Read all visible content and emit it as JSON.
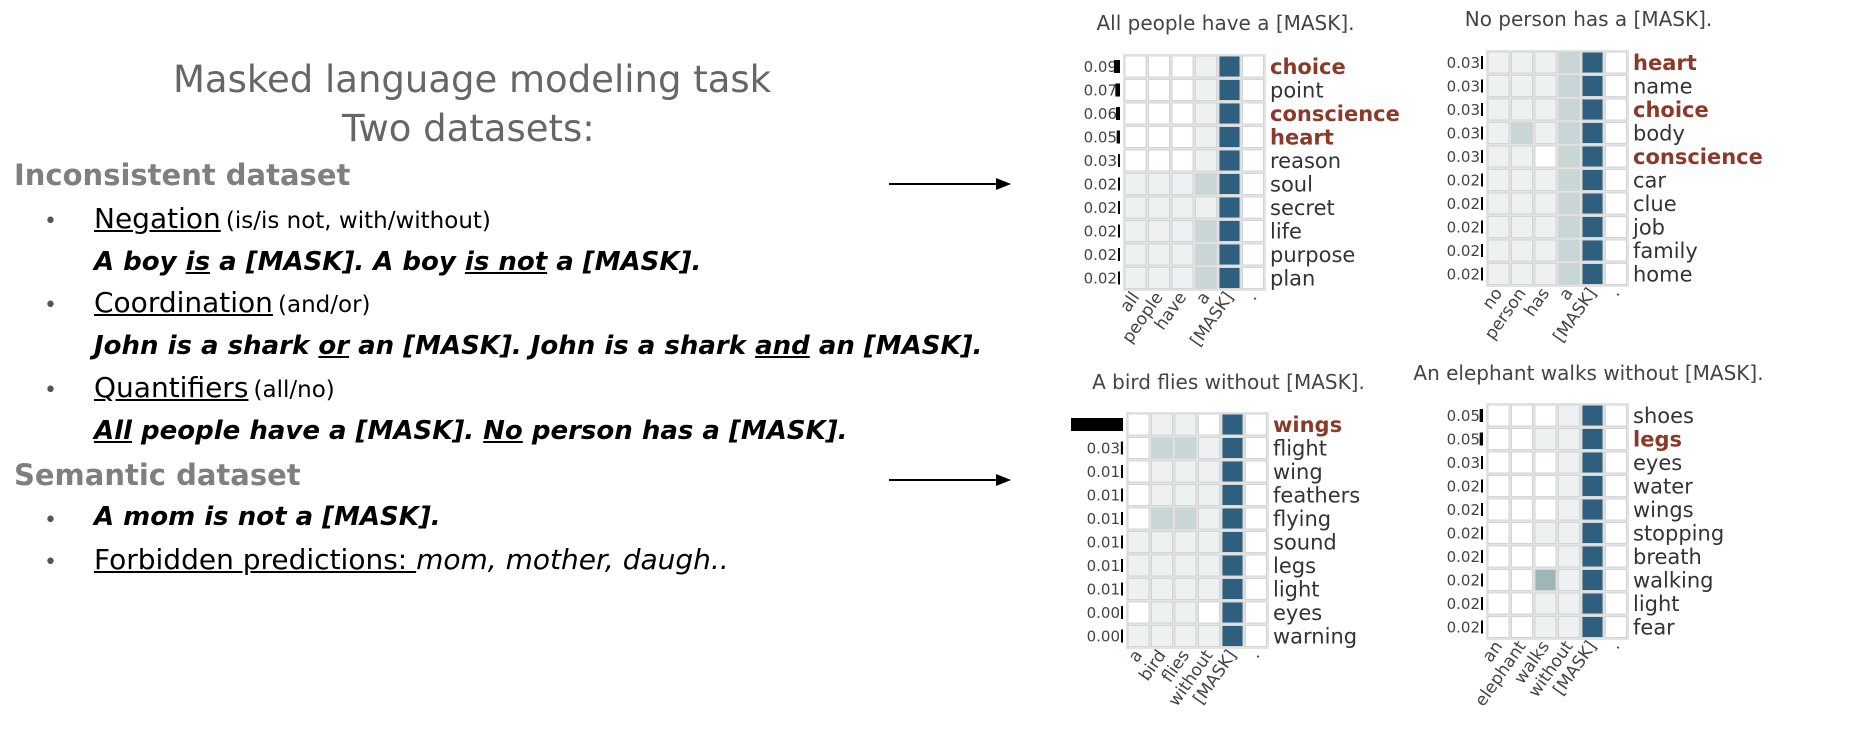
{
  "left": {
    "title_line1": "Masked language modeling task",
    "title_line2": "Two datasets:",
    "inconsistent_heading": "Inconsistent dataset",
    "items": [
      {
        "label": "Negation",
        "note": "(is/is not, with/without)",
        "example_parts": [
          "A boy ",
          "is",
          " a [MASK]. A boy ",
          "is not",
          " a [MASK]."
        ]
      },
      {
        "label": "Coordination",
        "note": "(and/or)",
        "example_parts": [
          "John is a shark ",
          "or",
          " an [MASK]. John is a shark ",
          "and",
          " an [MASK]."
        ]
      },
      {
        "label": "Quantifiers",
        "note": "(all/no)",
        "example_parts": [
          "",
          "All",
          " people have a [MASK]. ",
          "No",
          " person has a [MASK]."
        ]
      }
    ],
    "semantic_heading": "Semantic dataset",
    "semantic_example": "A mom is not a [MASK].",
    "forbidden_label": "Forbidden predictions: ",
    "forbidden_values": "mom, mother, daugh.."
  },
  "colors": {
    "highlight": "#8b3a2a",
    "mask_column": "#2e5f7e",
    "cell_light": "#eef1f1",
    "cell_mid": "#c9d6d6",
    "cell_dark": "#9fb6b8",
    "bar": "#000000",
    "grid_border": "#d4d4d4"
  },
  "panels": [
    {
      "title": "All people have a [MASK].",
      "tokens": [
        "all",
        "people",
        "have",
        "a",
        "[MASK]",
        "."
      ],
      "words": [
        "choice",
        "point",
        "conscience",
        "heart",
        "reason",
        "soul",
        "secret",
        "life",
        "purpose",
        "plan"
      ],
      "probs": [
        "0.09",
        "0.07",
        "0.06",
        "0.05",
        "0.03",
        "0.02",
        "0.02",
        "0.02",
        "0.02",
        "0.02"
      ],
      "highlighted": [
        0,
        2,
        3
      ],
      "shades": [
        [
          0,
          0,
          0,
          1,
          4,
          0
        ],
        [
          0,
          0,
          0,
          1,
          4,
          0
        ],
        [
          0,
          0,
          0,
          1,
          4,
          0
        ],
        [
          0,
          0,
          0,
          1,
          4,
          0
        ],
        [
          0,
          0,
          0,
          1,
          4,
          0
        ],
        [
          1,
          1,
          1,
          2,
          4,
          0
        ],
        [
          1,
          1,
          1,
          1,
          4,
          0
        ],
        [
          1,
          1,
          1,
          2,
          4,
          0
        ],
        [
          1,
          1,
          1,
          2,
          4,
          0
        ],
        [
          1,
          1,
          1,
          2,
          4,
          0
        ]
      ]
    },
    {
      "title": "No person has a [MASK].",
      "tokens": [
        "no",
        "person",
        "has",
        "a",
        "[MASK]",
        "."
      ],
      "words": [
        "heart",
        "name",
        "choice",
        "body",
        "conscience",
        "car",
        "clue",
        "job",
        "family",
        "home"
      ],
      "probs": [
        "0.03",
        "0.03",
        "0.03",
        "0.03",
        "0.03",
        "0.02",
        "0.02",
        "0.02",
        "0.02",
        "0.02"
      ],
      "highlighted": [
        0,
        2,
        4
      ],
      "shades": [
        [
          1,
          1,
          1,
          2,
          4,
          0
        ],
        [
          1,
          1,
          1,
          2,
          4,
          0
        ],
        [
          1,
          1,
          1,
          2,
          4,
          0
        ],
        [
          1,
          2,
          1,
          2,
          4,
          0
        ],
        [
          1,
          1,
          0,
          2,
          4,
          0
        ],
        [
          1,
          1,
          1,
          2,
          4,
          0
        ],
        [
          1,
          1,
          1,
          2,
          4,
          0
        ],
        [
          1,
          1,
          1,
          2,
          4,
          0
        ],
        [
          1,
          1,
          1,
          2,
          4,
          0
        ],
        [
          1,
          1,
          1,
          2,
          4,
          0
        ]
      ]
    },
    {
      "title": "A bird flies without [MASK].",
      "tokens": [
        "a",
        "bird",
        "flies",
        "without",
        "[MASK]",
        "."
      ],
      "words": [
        "wings",
        "flight",
        "wing",
        "feathers",
        "flying",
        "sound",
        "legs",
        "light",
        "eyes",
        "warning"
      ],
      "probs": [
        "0.73",
        "0.03",
        "0.01",
        "0.01",
        "0.01",
        "0.01",
        "0.01",
        "0.01",
        "0.00",
        "0.00"
      ],
      "highlighted": [
        0
      ],
      "shades": [
        [
          0,
          1,
          1,
          0,
          4,
          0
        ],
        [
          0,
          2,
          2,
          1,
          4,
          0
        ],
        [
          0,
          1,
          1,
          1,
          4,
          0
        ],
        [
          0,
          1,
          1,
          1,
          4,
          0
        ],
        [
          0,
          2,
          2,
          1,
          4,
          0
        ],
        [
          1,
          1,
          1,
          1,
          4,
          0
        ],
        [
          1,
          1,
          1,
          1,
          4,
          0
        ],
        [
          1,
          1,
          1,
          1,
          4,
          0
        ],
        [
          0,
          1,
          1,
          0,
          4,
          0
        ],
        [
          1,
          1,
          1,
          1,
          4,
          0
        ]
      ]
    },
    {
      "title": "An elephant walks without [MASK].",
      "tokens": [
        "an",
        "elephant",
        "walks",
        "without",
        "[MASK]",
        "."
      ],
      "words": [
        "shoes",
        "legs",
        "eyes",
        "water",
        "wings",
        "stopping",
        "breath",
        "walking",
        "light",
        "fear"
      ],
      "probs": [
        "0.05",
        "0.05",
        "0.03",
        "0.02",
        "0.02",
        "0.02",
        "0.02",
        "0.02",
        "0.02",
        "0.02"
      ],
      "highlighted": [
        1
      ],
      "shades": [
        [
          0,
          0,
          0,
          1,
          4,
          0
        ],
        [
          0,
          0,
          1,
          1,
          4,
          0
        ],
        [
          0,
          0,
          0,
          1,
          4,
          0
        ],
        [
          0,
          0,
          0,
          1,
          4,
          0
        ],
        [
          0,
          0,
          0,
          1,
          4,
          0
        ],
        [
          0,
          0,
          1,
          1,
          4,
          0
        ],
        [
          0,
          0,
          0,
          1,
          4,
          0
        ],
        [
          0,
          0,
          3,
          1,
          4,
          0
        ],
        [
          0,
          0,
          1,
          1,
          4,
          0
        ],
        [
          0,
          0,
          1,
          1,
          4,
          0
        ]
      ]
    }
  ]
}
